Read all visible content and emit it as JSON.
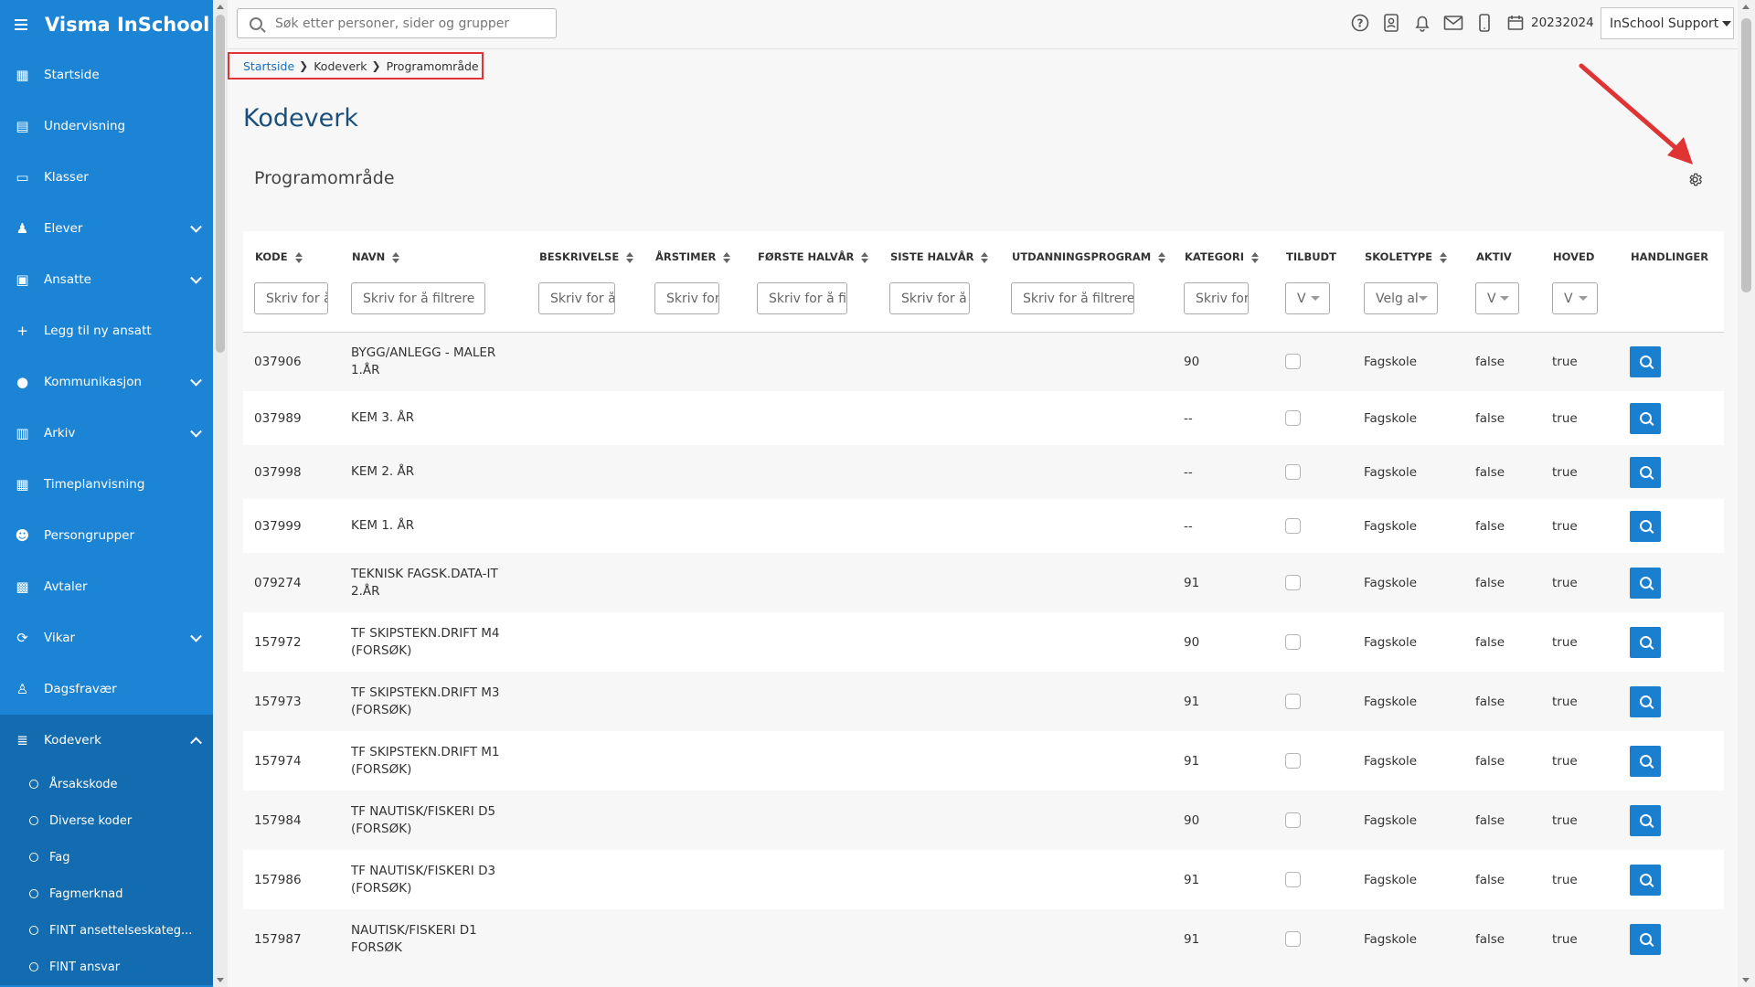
{
  "app": {
    "title": "Visma InSchool"
  },
  "sidebar": {
    "items": [
      {
        "label": "Startside",
        "icon": "grid-icon",
        "chevron": false
      },
      {
        "label": "Undervisning",
        "icon": "book-icon",
        "chevron": false
      },
      {
        "label": "Klasser",
        "icon": "classroom-icon",
        "chevron": false
      },
      {
        "label": "Elever",
        "icon": "student-icon",
        "chevron": true
      },
      {
        "label": "Ansatte",
        "icon": "briefcase-icon",
        "chevron": true
      },
      {
        "label": "Legg til ny ansatt",
        "icon": "plus-icon",
        "chevron": false
      },
      {
        "label": "Kommunikasjon",
        "icon": "chat-icon",
        "chevron": true
      },
      {
        "label": "Arkiv",
        "icon": "archive-icon",
        "chevron": true
      },
      {
        "label": "Timeplanvisning",
        "icon": "calendar-icon",
        "chevron": false
      },
      {
        "label": "Persongrupper",
        "icon": "users-icon",
        "chevron": false
      },
      {
        "label": "Avtaler",
        "icon": "calendar-check-icon",
        "chevron": false
      },
      {
        "label": "Vikar",
        "icon": "sync-icon",
        "chevron": true
      },
      {
        "label": "Dagsfravær",
        "icon": "user-x-icon",
        "chevron": false
      },
      {
        "label": "Kodeverk",
        "icon": "database-icon",
        "chevron": true
      }
    ],
    "subitems": [
      "Årsakskode",
      "Diverse koder",
      "Fag",
      "Fagmerknad",
      "FINT ansettelseskateg...",
      "FINT ansvar"
    ]
  },
  "topbar": {
    "search_placeholder": "Søk etter personer, sider og grupper",
    "year": "20232024",
    "user": "InSchool Support"
  },
  "breadcrumb": {
    "home": "Startside",
    "middle": "Kodeverk",
    "current": "Programområde"
  },
  "page": {
    "title": "Kodeverk",
    "panel_title": "Programområde"
  },
  "table": {
    "headers": [
      "KODE",
      "NAVN",
      "BESKRIVELSE",
      "ÅRSTIMER",
      "FØRSTE HALVÅR",
      "SISTE HALVÅR",
      "UTDANNINGSPROGRAM",
      "KATEGORI",
      "TILBUDT",
      "SKOLETYPE",
      "AKTIV",
      "HOVED",
      "HANDLINGER"
    ],
    "filters": [
      "Skriv for å filtrere",
      "Skriv for å filtrere",
      "Skriv for å filtrere",
      "Skriv for å filtrere",
      "Skriv for å filtrere",
      "Skriv for å filtrere",
      "Skriv for å filtrere",
      "Skriv for å filtrere",
      "V",
      "Velg alle",
      "V",
      "V"
    ],
    "rows": [
      {
        "kode": "037906",
        "navn": "BYGG/ANLEGG - MALER 1.ÅR",
        "kategori": "90",
        "skoletype": "Fagskole",
        "aktiv": "false",
        "hoved": "true"
      },
      {
        "kode": "037989",
        "navn": "KEM 3. ÅR",
        "kategori": "--",
        "skoletype": "Fagskole",
        "aktiv": "false",
        "hoved": "true"
      },
      {
        "kode": "037998",
        "navn": "KEM 2. ÅR",
        "kategori": "--",
        "skoletype": "Fagskole",
        "aktiv": "false",
        "hoved": "true"
      },
      {
        "kode": "037999",
        "navn": "KEM 1. ÅR",
        "kategori": "--",
        "skoletype": "Fagskole",
        "aktiv": "false",
        "hoved": "true"
      },
      {
        "kode": "079274",
        "navn": "TEKNISK FAGSK.DATA-IT 2.ÅR",
        "kategori": "91",
        "skoletype": "Fagskole",
        "aktiv": "false",
        "hoved": "true"
      },
      {
        "kode": "157972",
        "navn": "TF SKIPSTEKN.DRIFT M4 (FORSØK)",
        "kategori": "90",
        "skoletype": "Fagskole",
        "aktiv": "false",
        "hoved": "true"
      },
      {
        "kode": "157973",
        "navn": "TF SKIPSTEKN.DRIFT M3 (FORSØK)",
        "kategori": "91",
        "skoletype": "Fagskole",
        "aktiv": "false",
        "hoved": "true"
      },
      {
        "kode": "157974",
        "navn": "TF SKIPSTEKN.DRIFT M1 (FORSØK)",
        "kategori": "91",
        "skoletype": "Fagskole",
        "aktiv": "false",
        "hoved": "true"
      },
      {
        "kode": "157984",
        "navn": "TF NAUTISK/FISKERI D5 (FORSØK)",
        "kategori": "90",
        "skoletype": "Fagskole",
        "aktiv": "false",
        "hoved": "true"
      },
      {
        "kode": "157986",
        "navn": "TF NAUTISK/FISKERI D3 (FORSØK)",
        "kategori": "91",
        "skoletype": "Fagskole",
        "aktiv": "false",
        "hoved": "true"
      },
      {
        "kode": "157987",
        "navn": "NAUTISK/FISKERI D1 FORSØK",
        "kategori": "91",
        "skoletype": "Fagskole",
        "aktiv": "false",
        "hoved": "true"
      }
    ]
  },
  "colors": {
    "sidebar": "#1b84d4",
    "sidebar_active": "#136bb0",
    "action": "#1b7fcf",
    "annotation": "#e03434"
  }
}
